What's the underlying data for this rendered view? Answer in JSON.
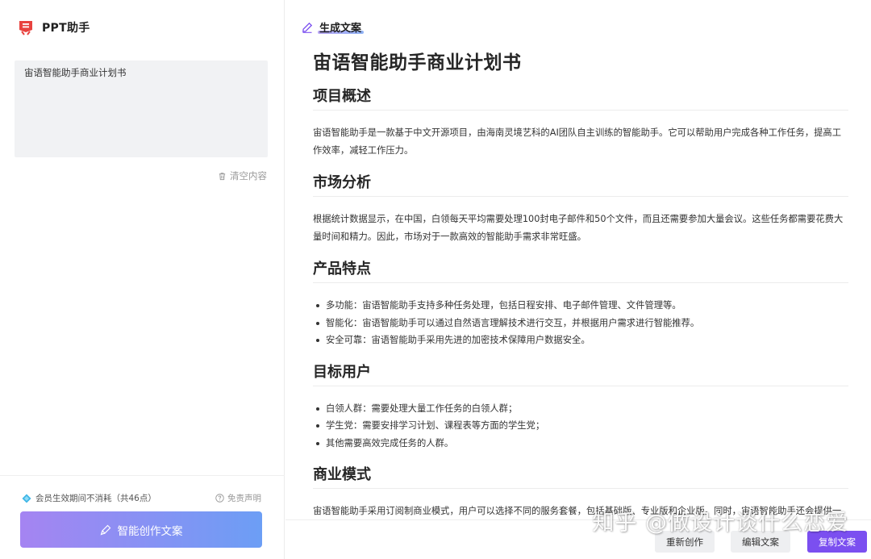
{
  "app": {
    "title": "PPT助手"
  },
  "prompt": {
    "value": "宙语智能助手商业计划书"
  },
  "clear_label": "清空内容",
  "member_note": "会员生效期间不消耗（共46点）",
  "disclaimer_label": "免责声明",
  "create_button_label": "智能创作文案",
  "generated": {
    "header_label": "生成文案",
    "doc_title": "宙语智能助手商业计划书",
    "sections": [
      {
        "title": "项目概述",
        "paragraph": "宙语智能助手是一款基于中文开源项目，由海南灵境艺科的AI团队自主训练的智能助手。它可以帮助用户完成各种工作任务，提高工作效率，减轻工作压力。"
      },
      {
        "title": "市场分析",
        "paragraph": "根据统计数据显示，在中国，白领每天平均需要处理100封电子邮件和50个文件，而且还需要参加大量会议。这些任务都需要花费大量时间和精力。因此，市场对于一款高效的智能助手需求非常旺盛。"
      },
      {
        "title": "产品特点",
        "bullets": [
          "多功能：宙语智能助手支持多种任务处理，包括日程安排、电子邮件管理、文件管理等。",
          "智能化：宙语智能助手可以通过自然语言理解技术进行交互，并根据用户需求进行智能推荐。",
          "安全可靠：宙语智能助手采用先进的加密技术保障用户数据安全。"
        ]
      },
      {
        "title": "目标用户",
        "bullets": [
          "白领人群：需要处理大量工作任务的白领人群；",
          "学生党：需要安排学习计划、课程表等方面的学生党；",
          "其他需要高效完成任务的人群。"
        ]
      },
      {
        "title": "商业模式",
        "paragraph": "宙语智能助手采用订阅制商业模式，用户可以选择不同的服务套餐，包括基础版、专业版和企业版。同时，宙语智能助手还会提供一些增值服务，如数据备份、多设备同步等。"
      }
    ]
  },
  "actions": {
    "regenerate": "重新创作",
    "edit": "编辑文案",
    "copy": "复制文案"
  },
  "watermark": "知乎 @做设计谈什么恋爱",
  "colors": {
    "accent": "#7b4ff0",
    "gradient_start": "#a584f2",
    "gradient_end": "#6c9ef5",
    "logo_red": "#e8433f"
  }
}
